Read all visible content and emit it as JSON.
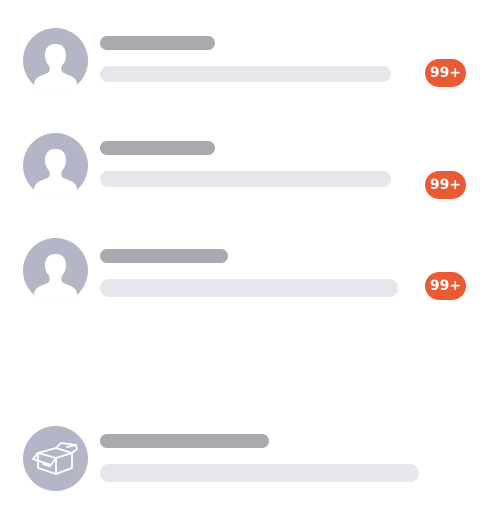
{
  "colors": {
    "avatar_bg": "#b4b5c6",
    "avatar_fg": "#ffffff",
    "title_bar": "#a9a9b0",
    "subtitle_bar": "#e6e6ec",
    "badge_bg": "#ec5a33",
    "badge_text": "#ffffff"
  },
  "conversations": [
    {
      "avatar_icon": "user-silhouette-icon",
      "unread_badge": "99+"
    },
    {
      "avatar_icon": "user-silhouette-icon",
      "unread_badge": "99+"
    },
    {
      "avatar_icon": "user-silhouette-icon",
      "unread_badge": "99+"
    }
  ],
  "system_item": {
    "avatar_icon": "open-box-icon"
  }
}
